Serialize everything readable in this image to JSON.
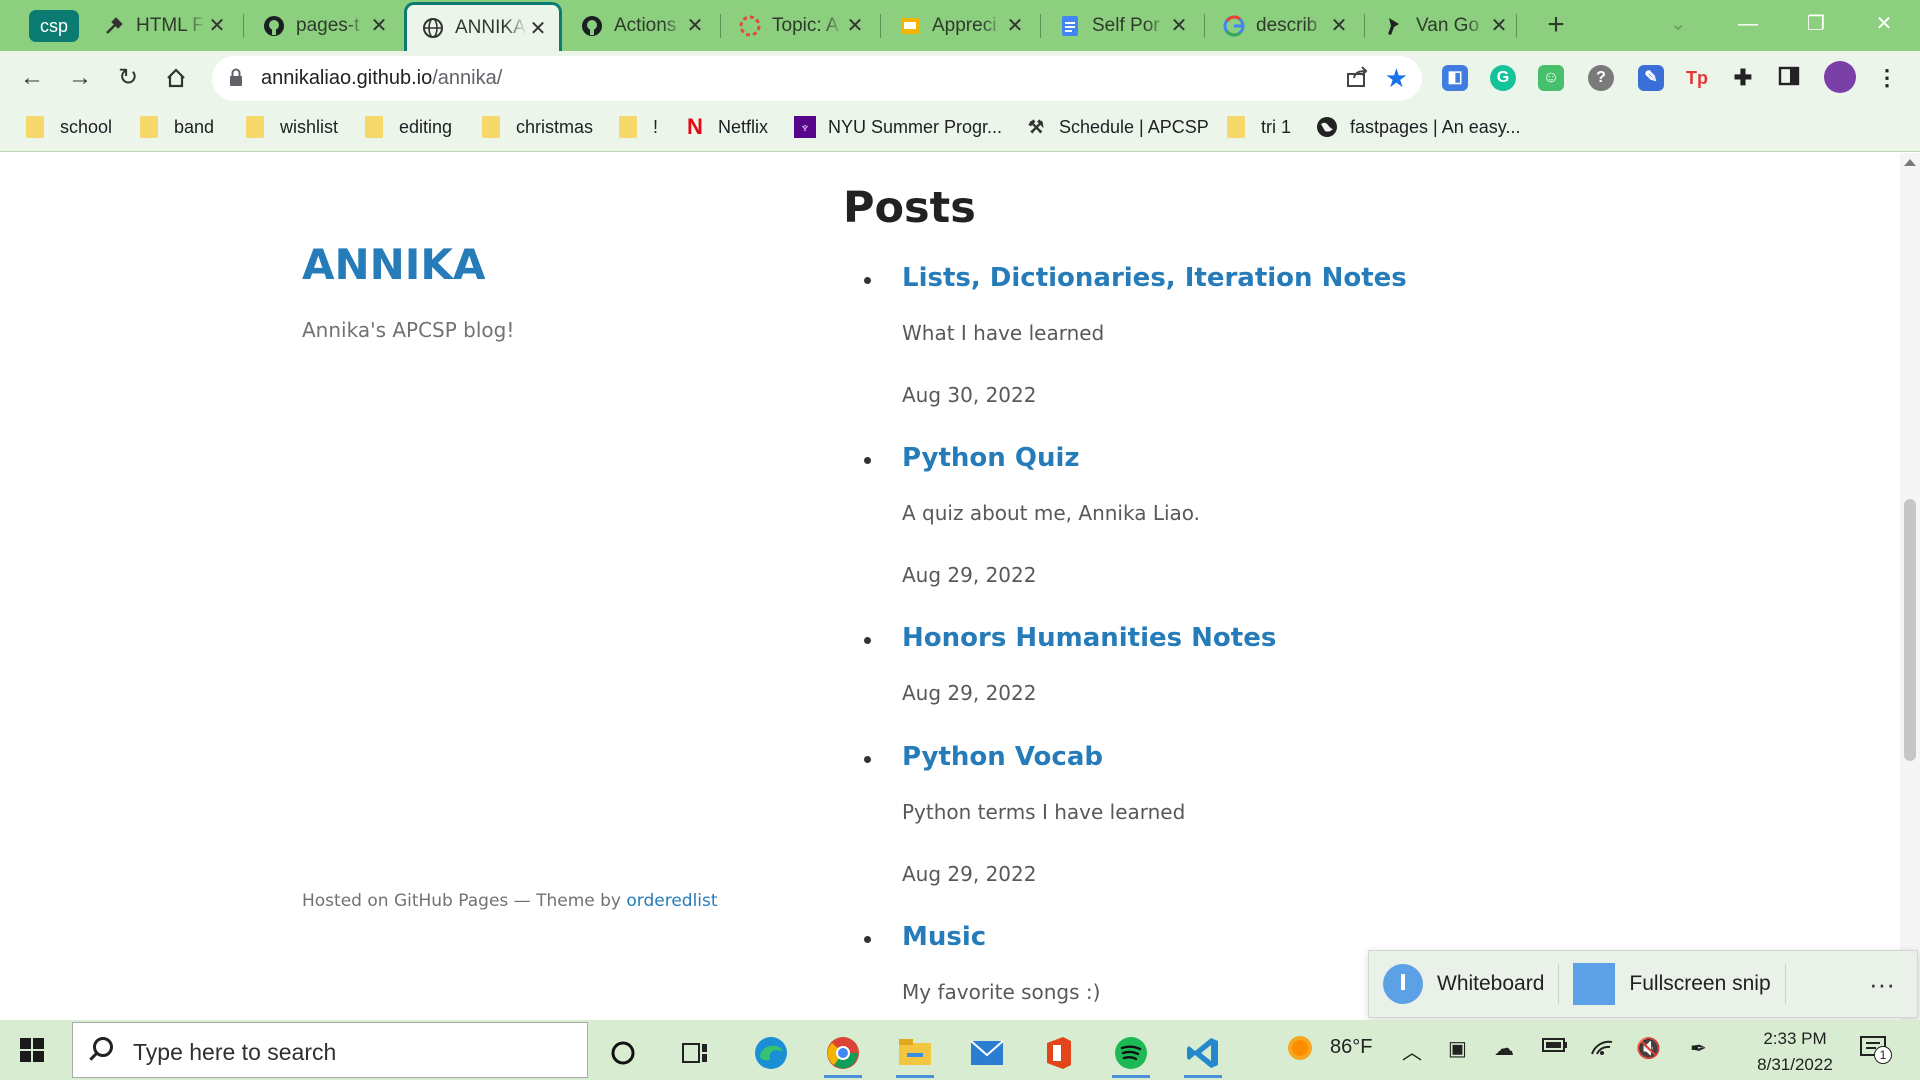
{
  "browser": {
    "group_label": "csp",
    "tabs": [
      {
        "title": "HTML F",
        "icon": "tools-icon"
      },
      {
        "title": "pages-t",
        "icon": "github-icon"
      },
      {
        "title": "ANNIKA",
        "icon": "globe-icon",
        "active": true
      },
      {
        "title": "Actions",
        "icon": "github-icon"
      },
      {
        "title": "Topic: A",
        "icon": "topic-icon"
      },
      {
        "title": "Appreci",
        "icon": "slides-icon"
      },
      {
        "title": "Self Por",
        "icon": "docs-icon"
      },
      {
        "title": "describ",
        "icon": "google-icon"
      },
      {
        "title": "Van Go",
        "icon": "pin-icon"
      }
    ],
    "url_host": "annikaliao.github.io",
    "url_path": "/annika/",
    "bookmarks": [
      "school",
      "band",
      "wishlist",
      "editing",
      "christmas",
      "!",
      "Netflix",
      "NYU Summer Progr...",
      "Schedule | APCSP",
      "tri 1",
      "fastpages | An easy..."
    ]
  },
  "site": {
    "title": "ANNIKA",
    "description": "Annika's APCSP blog!",
    "footer_prefix": "Hosted on GitHub Pages — Theme by ",
    "footer_link": "orderedlist"
  },
  "posts": {
    "heading": "Posts",
    "items": [
      {
        "title": "Lists, Dictionaries, Iteration Notes",
        "description": "What I have learned",
        "date": "Aug 30, 2022"
      },
      {
        "title": "Python Quiz",
        "description": "A quiz about me, Annika Liao.",
        "date": "Aug 29, 2022"
      },
      {
        "title": "Honors Humanities Notes",
        "description": "",
        "date": "Aug 29, 2022"
      },
      {
        "title": "Python Vocab",
        "description": "Python terms I have learned",
        "date": "Aug 29, 2022"
      },
      {
        "title": "Music",
        "description": "My favorite songs :)",
        "date": ""
      }
    ]
  },
  "snip": {
    "option1": "Whiteboard",
    "option2": "Fullscreen snip",
    "more": "···"
  },
  "taskbar": {
    "search_placeholder": "Type here to search",
    "temperature": "86°F",
    "time": "2:33 PM",
    "date": "8/31/2022",
    "notification_count": "1"
  },
  "colors": {
    "tabbar": "#8ccf7e",
    "toolbar": "#ecf5ea",
    "link": "#267cb9",
    "group": "#0b7b72"
  }
}
